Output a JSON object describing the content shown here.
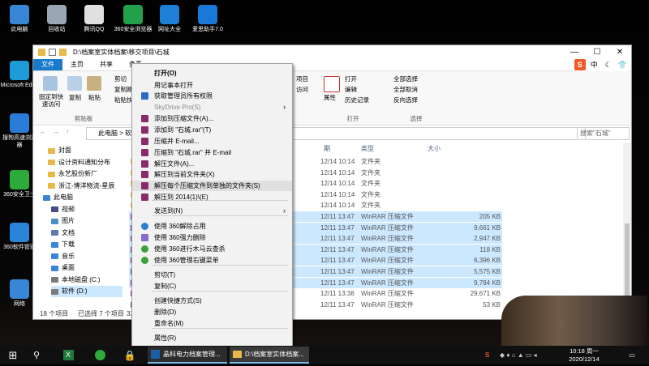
{
  "desktop_icons": [
    {
      "label": "此电脑",
      "icon": "pc-icon",
      "color": "#3a86d6"
    },
    {
      "label": "回收站",
      "icon": "recycle-bin-icon",
      "color": "#9aa6b2"
    },
    {
      "label": "腾讯QQ",
      "icon": "qq-icon",
      "color": "#e0e0e0"
    },
    {
      "label": "360安全浏览器",
      "icon": "360-browser-icon",
      "color": "#22a04a"
    },
    {
      "label": "网址大全",
      "icon": "ie-icon",
      "color": "#1e7fd6"
    },
    {
      "label": "爱思助手7.0",
      "icon": "i4-icon",
      "color": "#1a78d8"
    },
    {
      "label": "Microsoft Edge",
      "icon": "edge-icon",
      "color": "#1d9bd8"
    },
    {
      "label": "搜狗高速浏览器",
      "icon": "sogou-browser-icon",
      "color": "#2a7cd6"
    },
    {
      "label": "360安全卫士",
      "icon": "360-safe-icon",
      "color": "#2eaa3c"
    },
    {
      "label": "360软件管家",
      "icon": "360-soft-icon",
      "color": "#2a84d8"
    },
    {
      "label": "网络",
      "icon": "network-icon",
      "color": "#3a86d6"
    }
  ],
  "window": {
    "path_title": "D:\\档案室实体档案\\移交项目\\石城",
    "tabs": [
      "文件",
      "主页",
      "共享",
      "查看"
    ],
    "ribbon": {
      "pin_label": "固定到快速访问",
      "copy_label": "复制",
      "paste_label": "粘贴",
      "cut_label": "剪切",
      "copy_path_label": "复制路径",
      "paste_shortcut_label": "粘贴快",
      "clipboard_caption": "剪贴板",
      "new_item_label": "项目",
      "easy_access_label": "访问",
      "properties_label": "属性",
      "open_label": "打开",
      "edit_label": "编辑",
      "history_label": "历史记录",
      "open_caption": "打开",
      "select_all_label": "全部选择",
      "select_none_label": "全部取消",
      "invert_label": "反向选择",
      "select_caption": "选择"
    },
    "address": "此电脑 > 软",
    "search_placeholder": "搜索\"石城\"",
    "nav_items": [
      {
        "label": "封面",
        "type": "folder"
      },
      {
        "label": "设计资料通知分布",
        "type": "folder"
      },
      {
        "label": "永艺股份新厂",
        "type": "folder"
      },
      {
        "label": "浙江-博洋物流-星辰",
        "type": "folder"
      },
      {
        "label": "此电脑",
        "type": "pc"
      },
      {
        "label": "视频",
        "type": "video"
      },
      {
        "label": "图片",
        "type": "pictures"
      },
      {
        "label": "文档",
        "type": "documents"
      },
      {
        "label": "下载",
        "type": "downloads"
      },
      {
        "label": "音乐",
        "type": "music"
      },
      {
        "label": "桌面",
        "type": "desktop"
      },
      {
        "label": "本地磁盘 (C:)",
        "type": "drive"
      },
      {
        "label": "软件 (D:)",
        "type": "drive"
      }
    ],
    "columns": [
      "名",
      "期",
      "类型",
      "大小"
    ],
    "rows": [
      {
        "date": "12/14 10:14",
        "type": "文件夹",
        "size": "",
        "selected": false
      },
      {
        "date": "12/14 10:14",
        "type": "文件夹",
        "size": "",
        "selected": false
      },
      {
        "date": "12/14 10:14",
        "type": "文件夹",
        "size": "",
        "selected": false
      },
      {
        "date": "12/14 10:14",
        "type": "文件夹",
        "size": "",
        "selected": false
      },
      {
        "date": "12/14 10:14",
        "type": "文件夹",
        "size": "",
        "selected": false
      },
      {
        "date": "12/11 13:47",
        "type": "WinRAR 压缩文件",
        "size": "205 KB",
        "selected": true
      },
      {
        "date": "12/11 13:47",
        "type": "WinRAR 压缩文件",
        "size": "9,661 KB",
        "selected": true
      },
      {
        "date": "12/11 13:47",
        "type": "WinRAR 压缩文件",
        "size": "2,947 KB",
        "selected": true
      },
      {
        "date": "12/11 13:47",
        "type": "WinRAR 压缩文件",
        "size": "118 KB",
        "selected": true
      },
      {
        "date": "12/11 13:47",
        "type": "WinRAR 压缩文件",
        "size": "6,396 KB",
        "selected": true
      },
      {
        "date": "12/11 13:47",
        "type": "WinRAR 压缩文件",
        "size": "5,575 KB",
        "selected": true
      },
      {
        "date": "12/11 13:47",
        "type": "WinRAR 压缩文件",
        "size": "9,784 KB",
        "selected": true
      },
      {
        "date": "12/11 13:38",
        "type": "WinRAR 压缩文件",
        "size": "29,671 KB",
        "selected": false
      },
      {
        "date": "12/11 13:47",
        "type": "WinRAR 压缩文件",
        "size": "53 KB",
        "selected": false
      }
    ],
    "status_count": "18 个项目",
    "status_selected": "已选择 7 个项目",
    "status_size": "33.8"
  },
  "context_menu": [
    {
      "label": "打开(O)",
      "icon": "",
      "bold": true
    },
    {
      "label": "用记事本打开",
      "icon": ""
    },
    {
      "label": "获取管理员所有权限",
      "icon": "shield-icon"
    },
    {
      "label": "SkyDrive Pro(S)",
      "icon": "",
      "disabled": true,
      "submenu": true
    },
    {
      "label": "添加到压缩文件(A)...",
      "icon": "winrar-icon"
    },
    {
      "label": "添加到 \"石城.rar\"(T)",
      "icon": "winrar-icon"
    },
    {
      "label": "压缩并 E-mail...",
      "icon": "winrar-icon"
    },
    {
      "label": "压缩到 \"石城.rar\" 并 E-mail",
      "icon": "winrar-icon"
    },
    {
      "label": "解压文件(A)...",
      "icon": "winrar-icon"
    },
    {
      "label": "解压到当前文件夹(X)",
      "icon": "winrar-icon"
    },
    {
      "label": "解压每个压缩文件到单独的文件夹(S)",
      "icon": "winrar-icon",
      "highlight": true
    },
    {
      "label": "解压到 2014(1)\\(E)",
      "icon": "winrar-icon"
    },
    {
      "label": "发送到(N)",
      "icon": "",
      "submenu": true
    },
    {
      "label": "使用 360解除占用",
      "icon": "360-unlock-icon"
    },
    {
      "label": "使用 360强力删除",
      "icon": "360-delete-icon"
    },
    {
      "label": "使用 360进行木马云查杀",
      "icon": "360-scan-icon"
    },
    {
      "label": "使用 360管理右键菜单",
      "icon": "360-menu-icon"
    },
    {
      "label": "剪切(T)",
      "icon": ""
    },
    {
      "label": "复制(C)",
      "icon": ""
    },
    {
      "label": "创建快捷方式(S)",
      "icon": ""
    },
    {
      "label": "删除(D)",
      "icon": ""
    },
    {
      "label": "重命名(M)",
      "icon": ""
    },
    {
      "label": "属性(R)",
      "icon": ""
    }
  ],
  "ime_toolbar": {
    "mode": "中"
  },
  "taskbar": {
    "windows": [
      {
        "label": "晶科电力档案管理...",
        "icon": "jinko-icon"
      },
      {
        "label": "D:\\档案室实体档案...",
        "icon": "folder-icon"
      }
    ],
    "time": "10:18 周一",
    "date": "2020/12/14"
  }
}
